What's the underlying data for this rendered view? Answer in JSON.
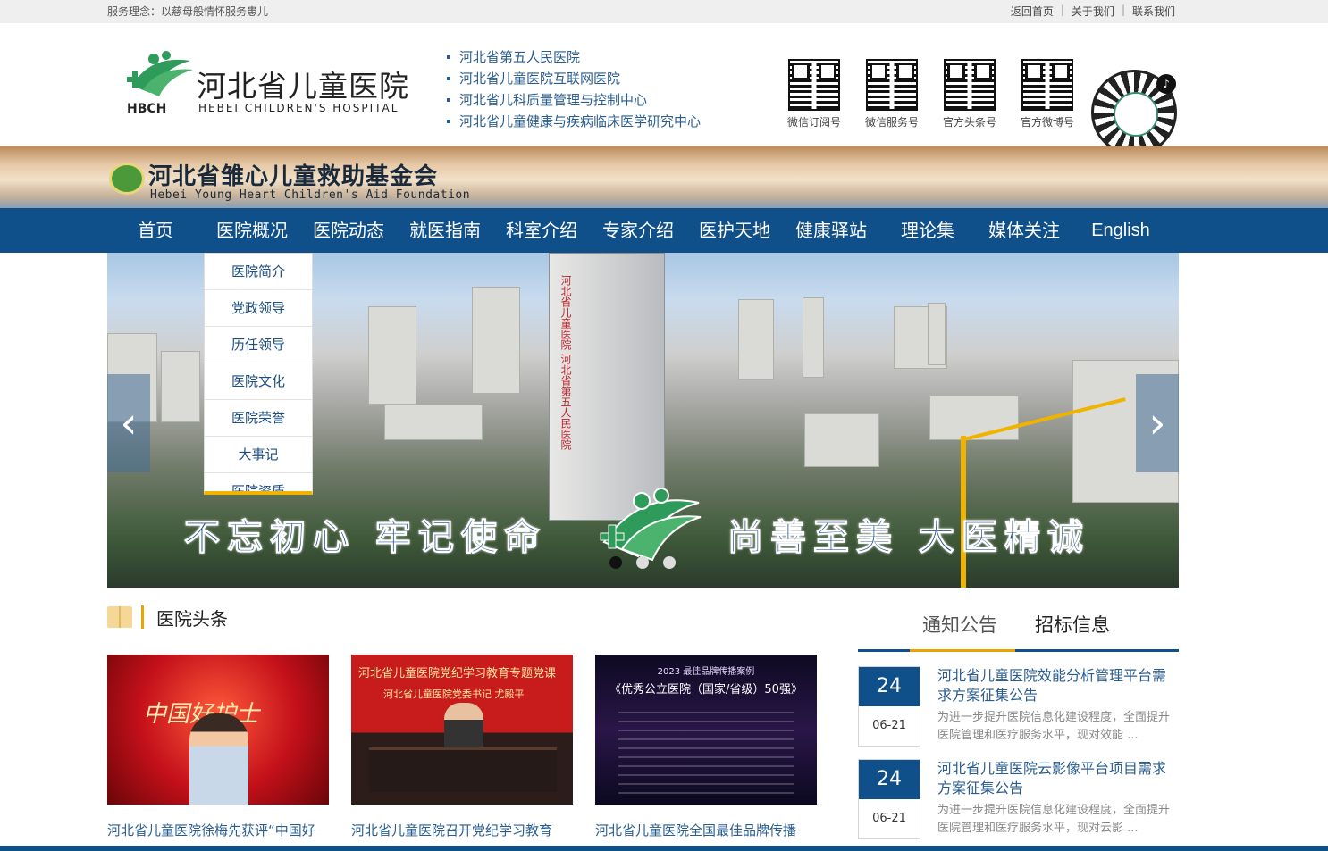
{
  "topbar": {
    "slogan": "服务理念：以慈母般情怀服务患儿",
    "links": [
      "返回首页",
      "关于我们",
      "联系我们"
    ]
  },
  "header": {
    "logo_abbr": "HBCH",
    "logo_cn": "河北省儿童医院",
    "logo_en": "HEBEI CHILDREN'S HOSPITAL",
    "sub_names": [
      "河北省第五人民医院",
      "河北省儿童医院互联网医院",
      "河北省儿科质量管理与控制中心",
      "河北省儿童健康与疾病临床医学研究中心"
    ],
    "qr_codes": [
      "微信订阅号",
      "微信服务号",
      "官方头条号",
      "官方微博号"
    ]
  },
  "foundation": {
    "cn": "河北省雏心儿童救助基金会",
    "en": "Hebei Young Heart Children's  Aid Foundation"
  },
  "nav": {
    "items": [
      "首页",
      "医院概况",
      "医院动态",
      "就医指南",
      "科室介绍",
      "专家介绍",
      "医护天地",
      "健康驿站",
      "理论集",
      "媒体关注",
      "English"
    ]
  },
  "dropdown": {
    "items": [
      "医院简介",
      "党政领导",
      "历任领导",
      "医院文化",
      "医院荣誉",
      "大事记",
      "医院资质"
    ]
  },
  "slider": {
    "tower_sign": "河北省儿童医院 河北省第五人民医院",
    "slogan_left": "不忘初心 牢记使命",
    "slogan_right": "尚善至美 大医精诚",
    "prev_glyph": "‹",
    "next_glyph": "›",
    "dots_count": 3,
    "active_dot": 1
  },
  "headlines": {
    "title": "医院头条",
    "cards": [
      {
        "caption": "河北省儿童医院徐梅先获评“中国好",
        "pic_text": "中国好护士"
      },
      {
        "caption": "河北省儿童医院召开党纪学习教育",
        "pic_text_1": "河北省儿童医院党纪学习教育专题党课",
        "pic_text_2": "河北省儿童医院党委书记  尤殿平"
      },
      {
        "caption": "河北省儿童医院全国最佳品牌传播",
        "pic_text_1": "2023 最佳品牌传播案例",
        "pic_text_2": "《优秀公立医院（国家/省级）50强》"
      }
    ]
  },
  "notices": {
    "tabs": [
      "通知公告",
      "招标信息"
    ],
    "items": [
      {
        "day": "24",
        "md": "06-21",
        "title": "河北省儿童医院效能分析管理平台需求方案征集公告",
        "desc": "为进一步提升医院信息化建设程度，全面提升医院管理和医疗服务水平，现对效能 ..."
      },
      {
        "day": "24",
        "md": "06-21",
        "title": "河北省儿童医院云影像平台项目需求方案征集公告",
        "desc": "为进一步提升医院信息化建设程度，全面提升医院管理和医疗服务水平，现对云影 ..."
      }
    ]
  },
  "colors": {
    "nav_blue": "#0f4f8a",
    "accent_gold": "#e8a400",
    "link_blue": "#2a5d8f"
  }
}
